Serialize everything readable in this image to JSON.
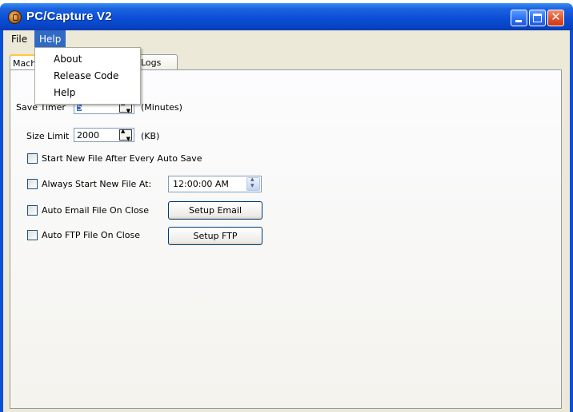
{
  "window": {
    "title": "PC/Capture V2",
    "close_glyph": "✕"
  },
  "menubar": {
    "file": "File",
    "help": "Help"
  },
  "help_menu": {
    "items": [
      "About",
      "Release Code",
      "Help"
    ]
  },
  "tabs": {
    "machine_partial": "Mach",
    "logs": "Logs"
  },
  "form": {
    "save_timer": {
      "label": "Save Timer",
      "value": "5",
      "unit": "(Minutes)"
    },
    "size_limit": {
      "label": "Size Limit",
      "value": "2000",
      "unit": "(KB)"
    },
    "start_new_after_autosave": {
      "label": "Start New File After Every Auto Save",
      "checked": false
    },
    "always_start_new_at": {
      "label": "Always Start New File At:",
      "checked": false,
      "time": "12:00:00 AM"
    },
    "auto_email": {
      "label": "Auto Email File On Close",
      "checked": false,
      "button": "Setup Email"
    },
    "auto_ftp": {
      "label": "Auto FTP File On Close",
      "checked": false,
      "button": "Setup FTP"
    }
  },
  "colors": {
    "titlebar": "#0a4fd6",
    "menu_highlight": "#316ac5",
    "dialog_bg": "#ece9d8"
  }
}
